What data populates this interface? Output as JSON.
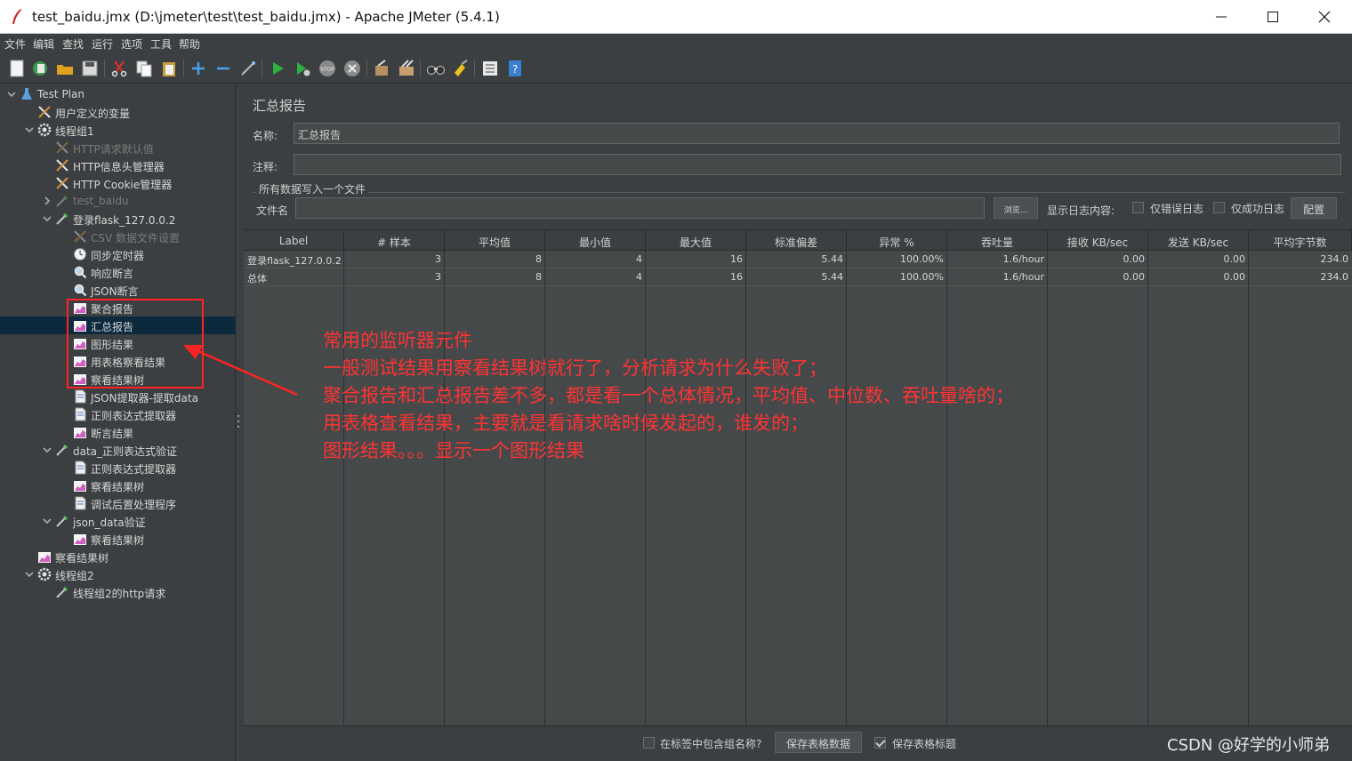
{
  "window": {
    "title": "test_baidu.jmx (D:\\jmeter\\test\\test_baidu.jmx) - Apache JMeter (5.4.1)"
  },
  "menu": [
    "文件",
    "编辑",
    "查找",
    "运行",
    "选项",
    "工具",
    "帮助"
  ],
  "tree": [
    {
      "label": "Test Plan",
      "indent": 0,
      "arrow": "down",
      "icon": "flask-icon",
      "disabled": false
    },
    {
      "label": "用户定义的变量",
      "indent": 1,
      "arrow": "",
      "icon": "tools-icon",
      "disabled": false
    },
    {
      "label": "线程组1",
      "indent": 1,
      "arrow": "down",
      "icon": "gear-icon",
      "disabled": false
    },
    {
      "label": "HTTP请求默认值",
      "indent": 2,
      "arrow": "",
      "icon": "tools-icon",
      "disabled": true
    },
    {
      "label": "HTTP信息头管理器",
      "indent": 2,
      "arrow": "",
      "icon": "tools-icon",
      "disabled": false
    },
    {
      "label": "HTTP Cookie管理器",
      "indent": 2,
      "arrow": "",
      "icon": "tools-icon",
      "disabled": false
    },
    {
      "label": "test_baidu",
      "indent": 2,
      "arrow": "right",
      "icon": "pipette-icon",
      "disabled": true
    },
    {
      "label": "登录flask_127.0.0.2",
      "indent": 2,
      "arrow": "down",
      "icon": "pipette-icon",
      "disabled": false
    },
    {
      "label": "CSV 数据文件设置",
      "indent": 3,
      "arrow": "",
      "icon": "tools-icon",
      "disabled": true
    },
    {
      "label": "同步定时器",
      "indent": 3,
      "arrow": "",
      "icon": "timer-icon",
      "disabled": false
    },
    {
      "label": "响应断言",
      "indent": 3,
      "arrow": "",
      "icon": "magnifier-icon",
      "disabled": false
    },
    {
      "label": "JSON断言",
      "indent": 3,
      "arrow": "",
      "icon": "magnifier-icon",
      "disabled": false
    },
    {
      "label": "聚合报告",
      "indent": 3,
      "arrow": "",
      "icon": "chart-icon",
      "disabled": false
    },
    {
      "label": "汇总报告",
      "indent": 3,
      "arrow": "",
      "icon": "chart-icon",
      "disabled": false,
      "selected": true
    },
    {
      "label": "图形结果",
      "indent": 3,
      "arrow": "",
      "icon": "chart-icon",
      "disabled": false
    },
    {
      "label": "用表格察看结果",
      "indent": 3,
      "arrow": "",
      "icon": "chart-icon",
      "disabled": false
    },
    {
      "label": "察看结果树",
      "indent": 3,
      "arrow": "",
      "icon": "chart-icon",
      "disabled": false
    },
    {
      "label": "JSON提取器-提取data",
      "indent": 3,
      "arrow": "",
      "icon": "document-icon",
      "disabled": false
    },
    {
      "label": "正则表达式提取器",
      "indent": 3,
      "arrow": "",
      "icon": "document-icon",
      "disabled": false
    },
    {
      "label": "断言结果",
      "indent": 3,
      "arrow": "",
      "icon": "chart-icon",
      "disabled": false
    },
    {
      "label": "data_正则表达式验证",
      "indent": 2,
      "arrow": "down",
      "icon": "pipette-icon",
      "disabled": false
    },
    {
      "label": "正则表达式提取器",
      "indent": 3,
      "arrow": "",
      "icon": "document-icon",
      "disabled": false
    },
    {
      "label": "察看结果树",
      "indent": 3,
      "arrow": "",
      "icon": "chart-icon",
      "disabled": false
    },
    {
      "label": "调试后置处理程序",
      "indent": 3,
      "arrow": "",
      "icon": "document-icon",
      "disabled": false
    },
    {
      "label": "json_data验证",
      "indent": 2,
      "arrow": "down",
      "icon": "pipette-icon",
      "disabled": false
    },
    {
      "label": "察看结果树",
      "indent": 3,
      "arrow": "",
      "icon": "chart-icon",
      "disabled": false
    },
    {
      "label": "察看结果树",
      "indent": 1,
      "arrow": "",
      "icon": "chart-icon",
      "disabled": false
    },
    {
      "label": "线程组2",
      "indent": 1,
      "arrow": "down",
      "icon": "gear-icon",
      "disabled": false
    },
    {
      "label": "线程组2的http请求",
      "indent": 2,
      "arrow": "",
      "icon": "pipette-icon",
      "disabled": false
    }
  ],
  "panel": {
    "title": "汇总报告",
    "name_label": "名称:",
    "name_value": "汇总报告",
    "comment_label": "注释:",
    "comment_value": "",
    "file_group_label": "所有数据写入一个文件",
    "filename_label": "文件名",
    "filename_value": "",
    "browse_button": "浏览...",
    "log_content_label": "显示日志内容:",
    "errors_only_label": "仅错误日志",
    "success_only_label": "仅成功日志",
    "configure_button": "配置"
  },
  "table": {
    "columns": [
      "Label",
      "# 样本",
      "平均值",
      "最小值",
      "最大值",
      "标准偏差",
      "异常 %",
      "吞吐量",
      "接收 KB/sec",
      "发送 KB/sec",
      "平均字节数"
    ],
    "rows": [
      [
        "登录flask_127.0.0.2",
        "3",
        "8",
        "4",
        "16",
        "5.44",
        "100.00%",
        "1.6/hour",
        "0.00",
        "0.00",
        "234.0"
      ],
      [
        "总体",
        "3",
        "8",
        "4",
        "16",
        "5.44",
        "100.00%",
        "1.6/hour",
        "0.00",
        "0.00",
        "234.0"
      ]
    ]
  },
  "bottom": {
    "include_group_label": "在标签中包含组名称?",
    "include_group_checked": false,
    "save_table_button": "保存表格数据",
    "save_header_label": "保存表格标题",
    "save_header_checked": true
  },
  "annotation": {
    "lines": [
      "常用的监听器元件",
      "一般测试结果用察看结果树就行了，分析请求为什么失败了；",
      "聚合报告和汇总报告差不多，都是看一个总体情况，平均值、中位数、吞吐量啥的；",
      "用表格查看结果，主要就是看请求啥时候发起的，谁发的；",
      "图形结果。。。显示一个图形结果"
    ],
    "color": "#ff3333"
  },
  "watermark": "CSDN @好学的小师弟"
}
